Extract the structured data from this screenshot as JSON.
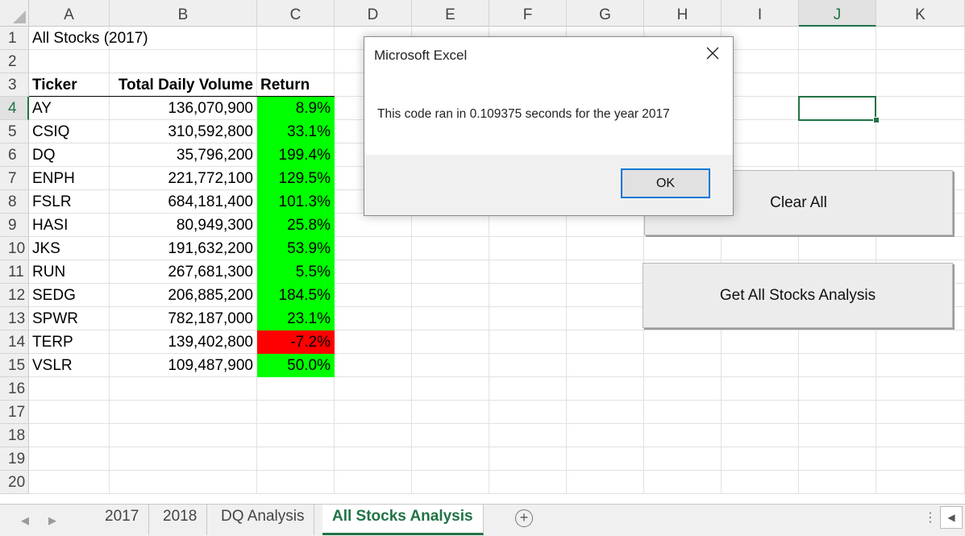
{
  "columns": [
    "A",
    "B",
    "C",
    "D",
    "E",
    "F",
    "G",
    "H",
    "I",
    "J",
    "K"
  ],
  "selected_column": "J",
  "rows": [
    "1",
    "2",
    "3",
    "4",
    "5",
    "6",
    "7",
    "8",
    "9",
    "10",
    "11",
    "12",
    "13",
    "14",
    "15",
    "16",
    "17",
    "18",
    "19",
    "20"
  ],
  "selected_row": "4",
  "sheet_title": "All Stocks (2017)",
  "headers": {
    "ticker": "Ticker",
    "volume": "Total Daily Volume",
    "return": "Return"
  },
  "stocks": [
    {
      "ticker": "AY",
      "volume": "136,070,900",
      "return": "8.9%",
      "status": "positive"
    },
    {
      "ticker": "CSIQ",
      "volume": "310,592,800",
      "return": "33.1%",
      "status": "positive"
    },
    {
      "ticker": "DQ",
      "volume": "35,796,200",
      "return": "199.4%",
      "status": "positive"
    },
    {
      "ticker": "ENPH",
      "volume": "221,772,100",
      "return": "129.5%",
      "status": "positive"
    },
    {
      "ticker": "FSLR",
      "volume": "684,181,400",
      "return": "101.3%",
      "status": "positive"
    },
    {
      "ticker": "HASI",
      "volume": "80,949,300",
      "return": "25.8%",
      "status": "positive"
    },
    {
      "ticker": "JKS",
      "volume": "191,632,200",
      "return": "53.9%",
      "status": "positive"
    },
    {
      "ticker": "RUN",
      "volume": "267,681,300",
      "return": "5.5%",
      "status": "positive"
    },
    {
      "ticker": "SEDG",
      "volume": "206,885,200",
      "return": "184.5%",
      "status": "positive"
    },
    {
      "ticker": "SPWR",
      "volume": "782,187,000",
      "return": "23.1%",
      "status": "positive"
    },
    {
      "ticker": "TERP",
      "volume": "139,402,800",
      "return": "-7.2%",
      "status": "negative"
    },
    {
      "ticker": "VSLR",
      "volume": "109,487,900",
      "return": "50.0%",
      "status": "positive"
    }
  ],
  "buttons": {
    "clear_all": "Clear All",
    "get_analysis": "Get All Stocks Analysis"
  },
  "dialog": {
    "title": "Microsoft Excel",
    "message": "This code ran in 0.109375 seconds for the year 2017",
    "ok_label": "OK"
  },
  "tabs": [
    {
      "label": "2017",
      "active": false
    },
    {
      "label": "2018",
      "active": false
    },
    {
      "label": "DQ Analysis",
      "active": false
    },
    {
      "label": "All Stocks Analysis",
      "active": true
    }
  ],
  "colors": {
    "positive": "#00ff00",
    "negative": "#ff0000",
    "accent": "#217346",
    "dialog_focus": "#0078d7"
  },
  "icons": {
    "close": "close-icon",
    "add_sheet": "add-sheet-icon",
    "nav_left": "nav-left-icon",
    "nav_right": "nav-right-icon",
    "more": "more-options-icon",
    "scroll_left": "scroll-left-icon"
  }
}
